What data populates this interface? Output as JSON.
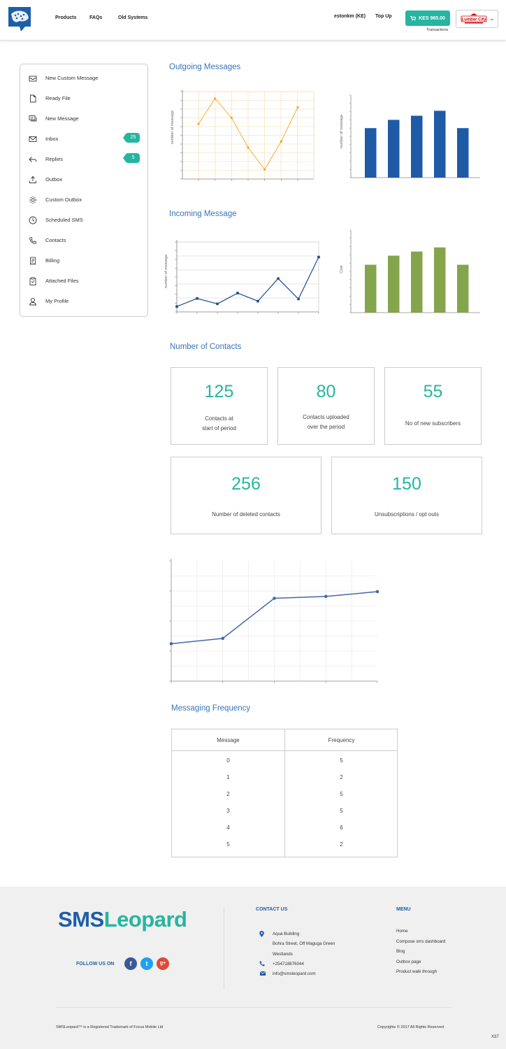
{
  "header": {
    "nav": [
      "Products",
      "FAQs",
      "Old Systems"
    ],
    "user": "estonkm (KE)",
    "topup": "Top Up",
    "balance": "KES 965.00",
    "transactions": "Transactions",
    "account_badge": "Lumber City"
  },
  "sidebar": {
    "items": [
      {
        "label": "New Custom Message",
        "icon": "envelope-icon"
      },
      {
        "label": "Ready File",
        "icon": "file-icon"
      },
      {
        "label": "New Message",
        "icon": "chat-icon"
      },
      {
        "label": "Inbox",
        "icon": "inbox-icon",
        "count": "25"
      },
      {
        "label": "Replies",
        "icon": "reply-icon",
        "count": "5"
      },
      {
        "label": "Outbox",
        "icon": "upload-icon"
      },
      {
        "label": "Custom Outbox",
        "icon": "gear-icon"
      },
      {
        "label": "Scheduled SMS",
        "icon": "clock-icon"
      },
      {
        "label": "Contacts",
        "icon": "phone-icon"
      },
      {
        "label": "Billing",
        "icon": "receipt-icon"
      },
      {
        "label": "Attached Files",
        "icon": "clipboard-icon"
      },
      {
        "label": "My Profile",
        "icon": "user-icon"
      }
    ]
  },
  "sections": {
    "outgoing": "Outgoing Messages",
    "incoming": "Incoming Message",
    "contacts": "Number of Contacts",
    "frequency": "Messaging Frequency"
  },
  "chart_data": [
    {
      "type": "line",
      "ylabel": "number of message",
      "values": [
        6.3,
        9.2,
        7.0,
        3.6,
        1.1,
        4.3,
        8.2
      ],
      "ylim": [
        0,
        10
      ],
      "color": "#f5a623",
      "grid": true
    },
    {
      "type": "bar",
      "ylabel": "number of message",
      "values": [
        60,
        70,
        75,
        81,
        60
      ],
      "ylim": [
        0,
        100
      ],
      "color": "#1f5aa6",
      "grid": false
    },
    {
      "type": "line",
      "ylabel": "number of message",
      "values": [
        1.0,
        2.5,
        1.5,
        3.5,
        2.0,
        6.2,
        2.4,
        10.2
      ],
      "ylim": [
        0,
        13
      ],
      "color": "#1f4e8c",
      "grid": true
    },
    {
      "type": "bar",
      "ylabel": "Cost",
      "values": [
        58,
        69,
        74,
        79,
        58
      ],
      "ylim": [
        0,
        100
      ],
      "color": "#85a54c",
      "grid": false
    },
    {
      "type": "line",
      "ylabel": "",
      "values": [
        14,
        16,
        31,
        31.7,
        33.5
      ],
      "ylim": [
        0,
        45
      ],
      "color": "#4666aa",
      "grid": true
    }
  ],
  "contacts": {
    "cards": [
      {
        "value": "125",
        "label": [
          "Contacts at",
          "start of period"
        ]
      },
      {
        "value": "80",
        "label": [
          "Contacts uploaded",
          "over the period"
        ]
      },
      {
        "value": "55",
        "label": [
          "No of new subscribers"
        ]
      },
      {
        "value": "256",
        "label": [
          "Number of deleted contacts"
        ]
      },
      {
        "value": "150",
        "label": [
          "Unsubscriptions / opt outs"
        ]
      }
    ]
  },
  "table": {
    "headers": [
      "Message",
      "Frequency"
    ],
    "rows": [
      [
        "0",
        "5"
      ],
      [
        "1",
        "2"
      ],
      [
        "2",
        "5"
      ],
      [
        "3",
        "5"
      ],
      [
        "4",
        "6"
      ],
      [
        "5",
        "2"
      ]
    ]
  },
  "footer": {
    "logo_sms": "SMS",
    "logo_leopard": "Leopard",
    "follow": "FOLLOW US ON",
    "social": [
      "f",
      "t",
      "g+"
    ],
    "contact_title": "CONTACT US",
    "address": [
      "Aqua Building",
      "Bohra Street, Off Maguga Green",
      "Westlands"
    ],
    "phone": "+254718876044",
    "email": "info@smsleopard.com",
    "menu_title": "MENU",
    "menu": [
      "Home",
      "Compose sms dashboard",
      "Blog",
      "Outbox page",
      "Product walk through"
    ],
    "trademark": "SMSLeopard™ is a Registered Trademark of Focus Mobile Ltd",
    "copyright": "Copyrights © 2017 All Rights Reserved",
    "corner": "X37"
  },
  "colors": {
    "teal": "#26b5a0",
    "blue": "#1d5ea8",
    "heading": "#3a73b9"
  }
}
